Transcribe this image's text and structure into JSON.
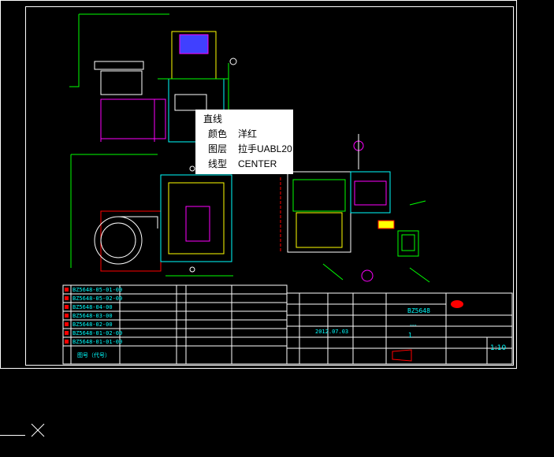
{
  "tooltip": {
    "title": "直线",
    "rows": [
      {
        "key": "颜色",
        "value": "洋红"
      },
      {
        "key": "图层",
        "value": "拉手UABL20"
      },
      {
        "key": "线型",
        "value": "CENTER"
      }
    ]
  },
  "bom": {
    "rows": [
      {
        "code": "BZ5648-05-01-00"
      },
      {
        "code": "BZ5648-05-02-00"
      },
      {
        "code": "BZ5648-04-00"
      },
      {
        "code": "BZ5648-03-00"
      },
      {
        "code": "BZ5648-02-00"
      },
      {
        "code": "BZ5648-01-02-00"
      },
      {
        "code": "BZ5648-01-01-00"
      }
    ],
    "header": {
      "code": "图号（代号）"
    }
  },
  "titleblock": {
    "drawing_no": "BZ5648",
    "date": "2012.07.03",
    "sheet": "1",
    "scale": "1:10",
    "dashes": "---"
  },
  "colors": {
    "bg": "#000000",
    "line": "#ffffff",
    "cyan": "#00ffff",
    "green": "#00ff00",
    "magenta": "#ff00ff",
    "yellow": "#ffff00",
    "red": "#ff0000",
    "blue": "#4040ff"
  }
}
